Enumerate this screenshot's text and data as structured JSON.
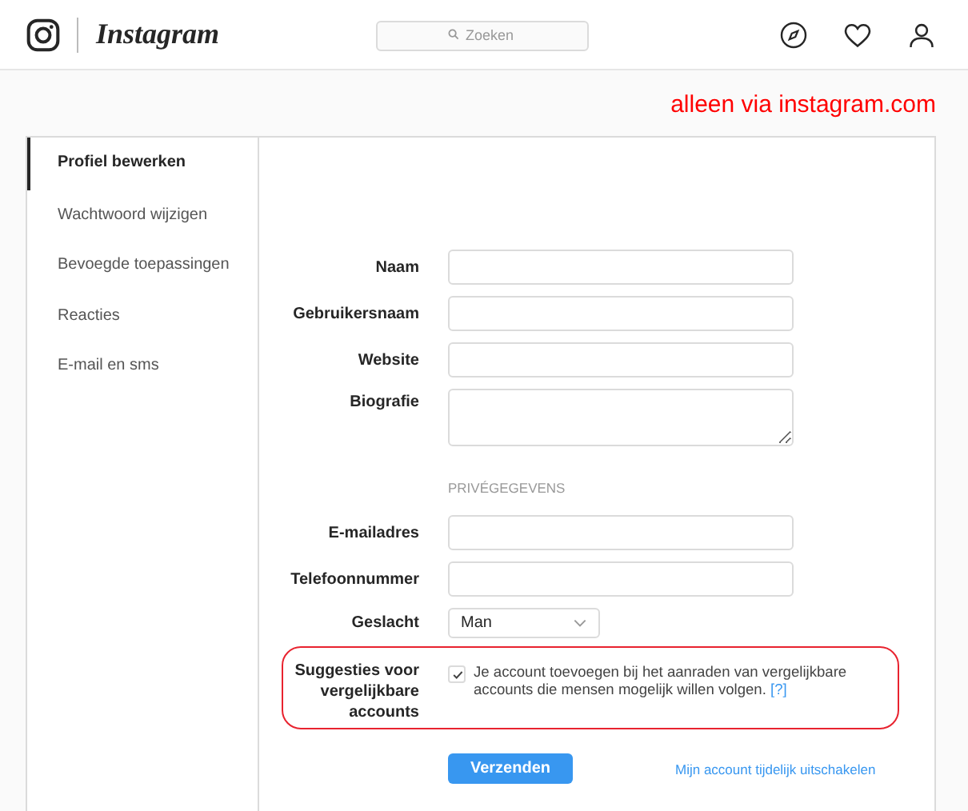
{
  "header": {
    "logo_text": "Instagram",
    "search": {
      "placeholder": "Zoeken"
    }
  },
  "annotation": "alleen via instagram.com",
  "sidebar": {
    "items": [
      {
        "label": "Profiel bewerken",
        "selected": true
      },
      {
        "label": "Wachtwoord wijzigen",
        "selected": false
      },
      {
        "label": "Bevoegde toepassingen",
        "selected": false
      },
      {
        "label": "Reacties",
        "selected": false
      },
      {
        "label": "E-mail en sms",
        "selected": false
      }
    ]
  },
  "form": {
    "rows": [
      {
        "kind": "input",
        "label": "Naam"
      },
      {
        "kind": "input",
        "label": "Gebruikersnaam"
      },
      {
        "kind": "input",
        "label": "Website"
      },
      {
        "kind": "textarea",
        "label": "Biografie"
      },
      {
        "kind": "heading",
        "label": "PRIVÉGEGEVENS"
      },
      {
        "kind": "input",
        "label": "E-mailadres"
      },
      {
        "kind": "input",
        "label": "Telefoonnummer"
      },
      {
        "kind": "select",
        "label": "Geslacht",
        "value": "Man"
      }
    ],
    "suggestions": {
      "label": "Suggesties voor vergelijkbare accounts",
      "checked": true,
      "text": "Je account toevoegen bij het aanraden van vergelijkbare accounts die mensen mogelijk willen volgen.",
      "help_link": "[?]",
      "highlighted": true
    },
    "submit": "Verzenden",
    "disable_link": "Mijn account tijdelijk uitschakelen"
  }
}
